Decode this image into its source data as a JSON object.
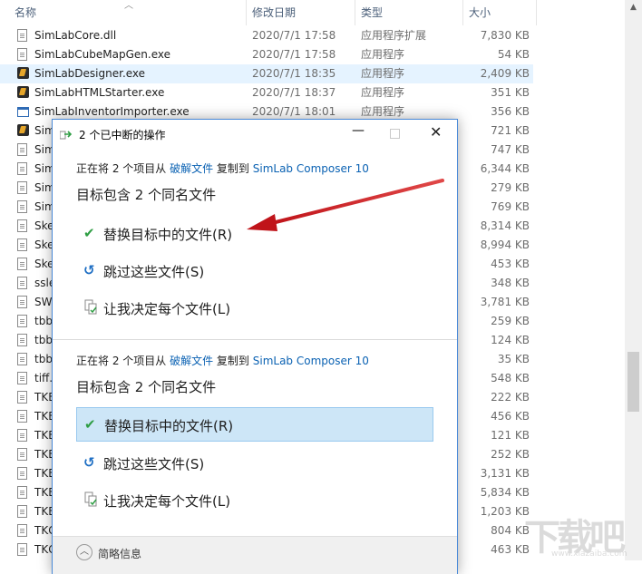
{
  "explorer": {
    "columns": {
      "name": "名称",
      "date": "修改日期",
      "type": "类型",
      "size": "大小"
    },
    "rows": [
      {
        "name": "SimLabCore.dll",
        "date": "2020/7/1 17:58",
        "type": "应用程序扩展",
        "size": "7,830 KB",
        "icon": "dll-file-icon"
      },
      {
        "name": "SimLabCubeMapGen.exe",
        "date": "2020/7/1 17:58",
        "type": "应用程序",
        "size": "54 KB",
        "icon": "file-icon"
      },
      {
        "name": "SimLabDesigner.exe",
        "date": "2020/7/1 18:35",
        "type": "应用程序",
        "size": "2,409 KB",
        "icon": "simlab-app-icon",
        "selected": true
      },
      {
        "name": "SimLabHTMLStarter.exe",
        "date": "2020/7/1 18:37",
        "type": "应用程序",
        "size": "351 KB",
        "icon": "simlab-app-icon"
      },
      {
        "name": "SimLabInventorImporter.exe",
        "date": "2020/7/1 18:01",
        "type": "应用程序",
        "size": "356 KB",
        "icon": "window-app-icon"
      },
      {
        "name": "Sim",
        "date": "",
        "type": "",
        "size": "721 KB",
        "icon": "simlab-app-icon"
      },
      {
        "name": "Sim",
        "date": "",
        "type": "",
        "size": "747 KB",
        "icon": "file-icon"
      },
      {
        "name": "Sim",
        "date": "",
        "type": "",
        "size": "6,344 KB",
        "icon": "file-icon"
      },
      {
        "name": "Sim",
        "date": "",
        "type": "",
        "size": "279 KB",
        "icon": "file-icon"
      },
      {
        "name": "Sim",
        "date": "",
        "type": "",
        "size": "769 KB",
        "icon": "file-icon"
      },
      {
        "name": "Ske",
        "date": "",
        "type": "",
        "size": "8,314 KB",
        "icon": "file-icon"
      },
      {
        "name": "Ske",
        "date": "",
        "type": "",
        "size": "8,994 KB",
        "icon": "file-icon"
      },
      {
        "name": "Ske",
        "date": "",
        "type": "",
        "size": "453 KB",
        "icon": "file-icon"
      },
      {
        "name": "ssle",
        "date": "",
        "type": "",
        "size": "348 KB",
        "icon": "file-icon"
      },
      {
        "name": "SW",
        "date": "",
        "type": "",
        "size": "3,781 KB",
        "icon": "file-icon"
      },
      {
        "name": "tbb",
        "date": "",
        "type": "",
        "size": "259 KB",
        "icon": "file-icon"
      },
      {
        "name": "tbb",
        "date": "",
        "type": "",
        "size": "124 KB",
        "icon": "file-icon"
      },
      {
        "name": "tbb",
        "date": "",
        "type": "",
        "size": "35 KB",
        "icon": "file-icon"
      },
      {
        "name": "tiff.",
        "date": "",
        "type": "",
        "size": "548 KB",
        "icon": "file-icon"
      },
      {
        "name": "TKE",
        "date": "",
        "type": "",
        "size": "222 KB",
        "icon": "file-icon"
      },
      {
        "name": "TKE",
        "date": "",
        "type": "",
        "size": "456 KB",
        "icon": "file-icon"
      },
      {
        "name": "TKE",
        "date": "",
        "type": "",
        "size": "121 KB",
        "icon": "file-icon"
      },
      {
        "name": "TKE",
        "date": "",
        "type": "",
        "size": "252 KB",
        "icon": "file-icon"
      },
      {
        "name": "TKE",
        "date": "",
        "type": "",
        "size": "3,131 KB",
        "icon": "file-icon"
      },
      {
        "name": "TKE",
        "date": "",
        "type": "",
        "size": "5,834 KB",
        "icon": "file-icon"
      },
      {
        "name": "TKE",
        "date": "",
        "type": "",
        "size": "1,203 KB",
        "icon": "file-icon"
      },
      {
        "name": "TKG",
        "date": "",
        "type": "",
        "size": "804 KB",
        "icon": "file-icon"
      },
      {
        "name": "TKG",
        "date": "",
        "type": "",
        "size": "463 KB",
        "icon": "file-icon"
      }
    ]
  },
  "dialog": {
    "title": "2 个已中断的操作",
    "sections": [
      {
        "status_prefix": "正在将 2 个项目从 ",
        "source": "破解文件",
        "status_mid": " 复制到 ",
        "dest": "SimLab Composer 10",
        "heading": "目标包含 2 个同名文件",
        "options": [
          {
            "label": "替换目标中的文件(R)",
            "icon": "checkmark-icon"
          },
          {
            "label": "跳过这些文件(S)",
            "icon": "skip-icon"
          },
          {
            "label": "让我决定每个文件(L)",
            "icon": "decide-files-icon"
          }
        ]
      },
      {
        "status_prefix": "正在将 2 个项目从 ",
        "source": "破解文件",
        "status_mid": " 复制到 ",
        "dest": "SimLab Composer 10",
        "heading": "目标包含 2 个同名文件",
        "selected_option": 0,
        "options": [
          {
            "label": "替换目标中的文件(R)",
            "icon": "checkmark-icon"
          },
          {
            "label": "跳过这些文件(S)",
            "icon": "skip-icon"
          },
          {
            "label": "让我决定每个文件(L)",
            "icon": "decide-files-icon"
          }
        ]
      }
    ],
    "footer": "简略信息"
  },
  "watermark": {
    "text": "下载吧",
    "sub": "www.xiazaiba.com"
  },
  "colors": {
    "link": "#0b62b3",
    "selection": "#cde6f7",
    "arrow": "#d42a2a",
    "check": "#2f9e44",
    "skip": "#1f6fc4"
  }
}
